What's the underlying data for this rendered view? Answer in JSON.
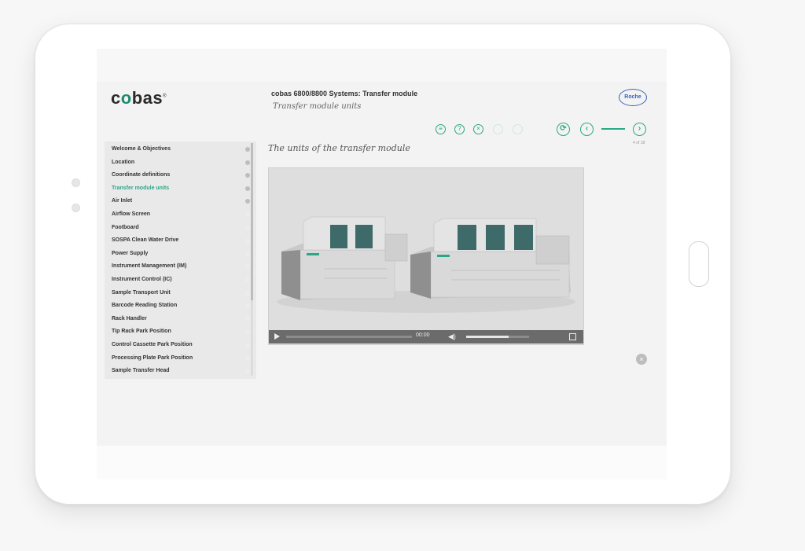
{
  "app": {
    "logo_text_pre": "c",
    "logo_text_o": "o",
    "logo_text_post": "bas",
    "logo_mark": "®",
    "course_title": "cobas 6800/8800 Systems: Transfer module",
    "page_subtitle": "Transfer module units",
    "brand_logo": "Roche"
  },
  "toolbar": {
    "tools": [
      {
        "name": "glossary-icon",
        "glyph": "≡"
      },
      {
        "name": "help-icon",
        "glyph": "?"
      },
      {
        "name": "close-icon",
        "glyph": "×"
      },
      {
        "name": "disabled-tool-icon",
        "glyph": ""
      },
      {
        "name": "disabled-tool-icon-2",
        "glyph": ""
      }
    ],
    "nav": {
      "reload_glyph": "⟳",
      "prev_glyph": "‹",
      "next_glyph": "›",
      "page_counter": "4 of 18"
    }
  },
  "menu": {
    "items": [
      {
        "label": "Welcome & Objectives",
        "state": "done"
      },
      {
        "label": "Location",
        "state": "done"
      },
      {
        "label": "Coordinate definitions",
        "state": "done"
      },
      {
        "label": "Transfer module units",
        "state": "active"
      },
      {
        "label": "Air Inlet",
        "state": "done"
      },
      {
        "label": "Airflow Screen",
        "state": "todo"
      },
      {
        "label": "Footboard",
        "state": "todo"
      },
      {
        "label": "SOSPA Clean Water Drive",
        "state": "todo"
      },
      {
        "label": "Power Supply",
        "state": "todo"
      },
      {
        "label": "Instrument Management (IM)",
        "state": "todo"
      },
      {
        "label": "Instrument Control (IC)",
        "state": "todo"
      },
      {
        "label": "Sample Transport Unit",
        "state": "todo"
      },
      {
        "label": "Barcode Reading Station",
        "state": "todo"
      },
      {
        "label": "Rack Handler",
        "state": "todo"
      },
      {
        "label": "Tip Rack Park Position",
        "state": "todo"
      },
      {
        "label": "Control Cassette Park Position",
        "state": "todo"
      },
      {
        "label": "Processing Plate Park Position",
        "state": "todo"
      },
      {
        "label": "Sample Transfer Head",
        "state": "todo"
      }
    ]
  },
  "content": {
    "section_heading": "The units of the transfer module",
    "video": {
      "time": "00:00",
      "volume_level": 0.68,
      "progress": 0.0
    },
    "close_glyph": "×"
  },
  "colors": {
    "accent": "#2aa886",
    "logo_o": "#1e8a6e",
    "roche_blue": "#3a63b8"
  }
}
